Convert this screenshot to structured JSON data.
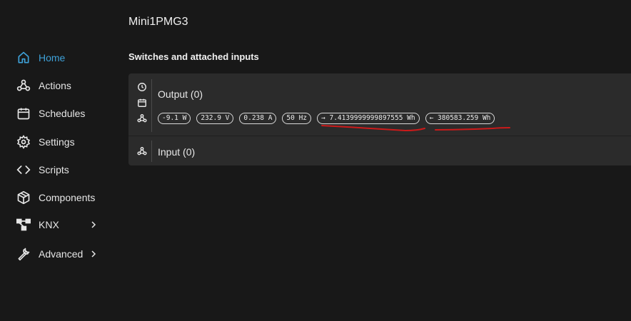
{
  "device": {
    "title": "Mini1PMG3"
  },
  "sidebar": {
    "items": [
      {
        "label": "Home",
        "icon": "home-icon",
        "active": true
      },
      {
        "label": "Actions",
        "icon": "webhook-icon"
      },
      {
        "label": "Schedules",
        "icon": "calendar-icon"
      },
      {
        "label": "Settings",
        "icon": "gear-icon"
      },
      {
        "label": "Scripts",
        "icon": "code-icon"
      },
      {
        "label": "Components",
        "icon": "components-icon"
      },
      {
        "label": "KNX",
        "icon": "knx-network-icon",
        "expandable": true
      },
      {
        "label": "Advanced",
        "icon": "wrench-icon",
        "expandable": true
      }
    ]
  },
  "main": {
    "section_heading": "Switches and attached inputs",
    "output": {
      "label": "Output (0)",
      "power": "-9.1 W",
      "voltage": "232.9 V",
      "current": "0.238 A",
      "frequency": "50 Hz",
      "energy_out": "→ 7.4139999999897555 Wh",
      "energy_in": "← 380583.259 Wh"
    },
    "input": {
      "label": "Input (0)"
    }
  },
  "colors": {
    "accent": "#3ea1d8",
    "background": "#181818",
    "card": "#2b2b2b",
    "annotation": "#cc1a1a"
  }
}
